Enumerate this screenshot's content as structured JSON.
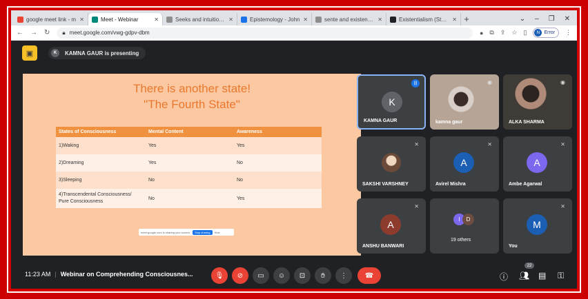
{
  "browser": {
    "tabs": [
      {
        "label": "google meet link - m",
        "color": "#ea4335",
        "active": false
      },
      {
        "label": "Meet - Webinar",
        "color": "#00897b",
        "active": true
      },
      {
        "label": "Seeks and intuition - I",
        "color": "#8e8e8e",
        "active": false
      },
      {
        "label": "Epistemology - John",
        "color": "#1a73e8",
        "active": false
      },
      {
        "label": "sente and existence p",
        "color": "#8e8e8e",
        "active": false
      },
      {
        "label": "Existentialism (Stanfo",
        "color": "#202124",
        "active": false
      }
    ],
    "new_tab": "+",
    "url": "meet.google.com/vwg-gdpv-dbm",
    "profile_initial": "N",
    "profile_label": "Error"
  },
  "meet": {
    "presenter_initial": "K",
    "presenting_text": "KAMNA GAUR is presenting",
    "slide": {
      "title_line1": "There is another state!",
      "title_line2": "\"The Fourth State\"",
      "headers": [
        "States of Consciousness",
        "Mental Content",
        "Awareness"
      ],
      "rows": [
        [
          "1)Waking",
          "Yes",
          "Yes"
        ],
        [
          "2)Dreaming",
          "Yes",
          "No"
        ],
        [
          "3)Sleeping",
          "No",
          "No"
        ],
        [
          "4)Transcendental Consciousness/ Pure Consciousness",
          "No",
          "Yes"
        ]
      ],
      "share_text": "meet.google.com is sharing your screen.",
      "stop_label": "Stop sharing",
      "hide_label": "Hide"
    },
    "participants": [
      {
        "name": "KAMNA GAUR",
        "initial": "K",
        "color": "#5f6368"
      },
      {
        "name": "kamna gaur",
        "initial": "",
        "color": ""
      },
      {
        "name": "ALKA SHARMA",
        "initial": "",
        "color": ""
      },
      {
        "name": "SAKSHI VARSHNEY",
        "initial": "",
        "color": ""
      },
      {
        "name": "Avirel Mishra",
        "initial": "A",
        "color": "#1a5fb4"
      },
      {
        "name": "Ambe Agarwal",
        "initial": "A",
        "color": "#7b68ee"
      },
      {
        "name": "ANSHU BANWARI",
        "initial": "A",
        "color": "#8d3b2c"
      },
      {
        "name": "19 others",
        "initial": "",
        "color": ""
      },
      {
        "name": "You",
        "initial": "M",
        "color": "#1a5fb4"
      }
    ],
    "others_initials": [
      "I",
      "D"
    ],
    "others_colors": [
      "#7b68ee",
      "#6d4c41"
    ],
    "time": "11:23 AM",
    "meeting_name": "Webinar on Comprehending Consciousnes...",
    "participant_count": "22"
  }
}
